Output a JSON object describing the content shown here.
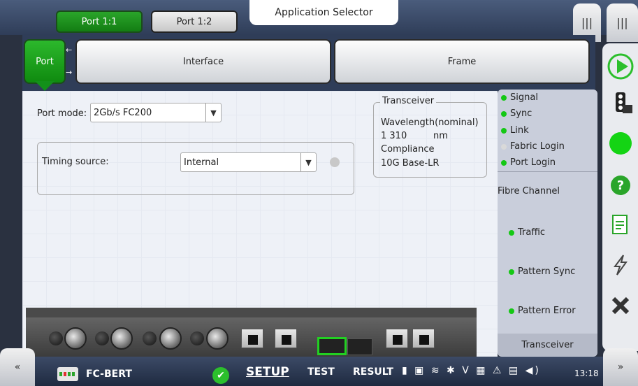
{
  "header": {
    "port_tabs": [
      "Port 1:1",
      "Port 1:2"
    ],
    "app_selector_label": "Application Selector",
    "menu_icons": [
      "menu-bars-icon",
      "menu-bars-icon"
    ]
  },
  "subtabs": {
    "port": "Port",
    "interface": "Interface",
    "frame": "Frame"
  },
  "port_settings": {
    "port_mode_label": "Port mode:",
    "port_mode_value": "2Gb/s FC200",
    "timing_source_label": "Timing source:",
    "timing_source_value": "Internal"
  },
  "transceiver": {
    "title": "Transceiver",
    "wavelength_label": "Wavelength(nominal)",
    "wavelength_value": "1 310",
    "wavelength_unit": "nm",
    "compliance_label": "Compliance",
    "compliance_value": "10G Base-LR"
  },
  "status_panel": {
    "items": [
      {
        "label": "Signal",
        "state": "green"
      },
      {
        "label": "Sync",
        "state": "green"
      },
      {
        "label": "Link",
        "state": "green"
      },
      {
        "label": "Fabric Login",
        "state": "grey"
      },
      {
        "label": "Port Login",
        "state": "green"
      }
    ],
    "section_label": "Fibre Channel",
    "fc_items": [
      {
        "label": "Traffic",
        "state": "green"
      },
      {
        "label": "Pattern Sync",
        "state": "green"
      },
      {
        "label": "Pattern Error",
        "state": "green"
      }
    ],
    "footer": "Transceiver"
  },
  "right_toolbar": {
    "icons": [
      "play-icon",
      "traffic-light-icon",
      "status-circle-icon",
      "help-icon",
      "report-icon",
      "lightning-icon",
      "close-icon"
    ],
    "colors": {
      "play": "#2cbf2c",
      "status": "#14d414",
      "help": "#2aa52a"
    }
  },
  "bottom_bar": {
    "app_name": "FC-BERT",
    "nav_setup": "SETUP",
    "nav_test": "TEST",
    "nav_result": "RESULT",
    "time": "13:18",
    "left_btn": "«",
    "right_btn": "»"
  },
  "colors": {
    "active_tab": "#1f9b1f",
    "indicator_green": "#14c814",
    "indicator_grey": "#d9d9d9"
  }
}
